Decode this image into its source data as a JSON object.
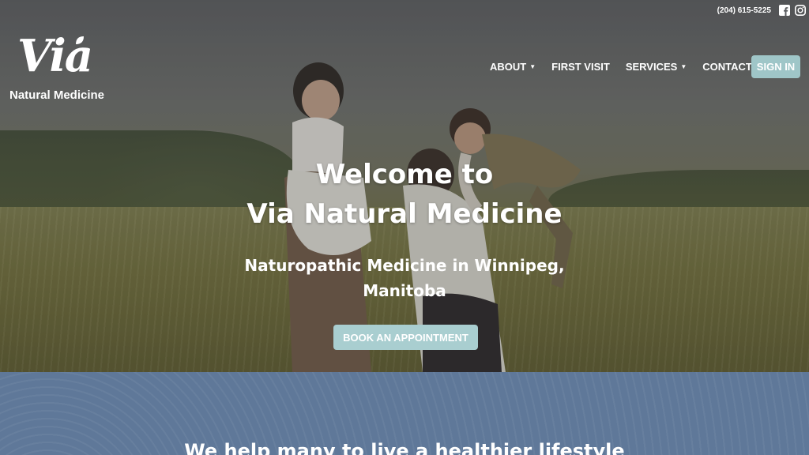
{
  "brand": {
    "logo_script": "Via",
    "logo_subtitle": "Natural Medicine"
  },
  "topbar": {
    "phone": "(204) 615-5225",
    "icons": [
      "facebook-icon",
      "instagram-icon"
    ]
  },
  "nav": {
    "items": [
      {
        "label": "ABOUT",
        "has_dropdown": true
      },
      {
        "label": "FIRST VISIT",
        "has_dropdown": false
      },
      {
        "label": "SERVICES",
        "has_dropdown": true
      },
      {
        "label": "CONTACT",
        "has_dropdown": false
      }
    ],
    "signin_label": "SIGN IN"
  },
  "hero": {
    "title_line1": "Welcome to",
    "title_line2": "Via Natural Medicine",
    "subtitle_line1": "Naturopathic Medicine in Winnipeg,",
    "subtitle_line2": "Manitoba",
    "cta_label": "BOOK AN APPOINTMENT"
  },
  "section": {
    "heading": "We help many to live a healthier lifestyle"
  },
  "colors": {
    "accent": "#9fc6c8",
    "band": "#5f7899"
  }
}
